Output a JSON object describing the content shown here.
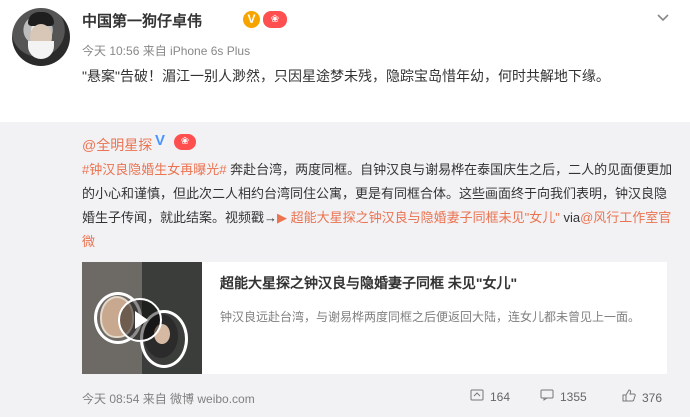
{
  "post": {
    "author": "中国第一狗仔卓伟",
    "verified_badge": "V",
    "vip_badge": "❀",
    "meta": "今天 10:56 来自 iPhone 6s Plus",
    "text": "\"悬案\"告破！湄江一别人渺然，只因星途梦未残，隐踪宝岛惜年幼，何时共解地下缘。",
    "menu_icon": "chevron-down-icon"
  },
  "repost": {
    "author": "@全明星探",
    "verified_badge": "V",
    "vip_badge": "❀",
    "hashtag": "#钟汉良隐婚生女再曝光#",
    "body": " 奔赴台湾，两度同框。自钟汉良与谢易桦在泰国庆生之后，二人的见面便更加的小心和谨慎，但此次二人相约台湾同住公寓，更是有同框合体。这些画面终于向我们表明，钟汉良隐婚生子传闻，就此结案。视频戳→",
    "video_link": "超能大星探之钟汉良与隐婚妻子同框未见\"女儿\"",
    "via_prefix": " via",
    "via_link": "@风行工作室官微",
    "card": {
      "title": "超能大星探之钟汉良与隐婚妻子同框 未见\"女儿\"",
      "description": "钟汉良远赴台湾，与谢易桦两度同框之后便返回大陆，连女儿都未曾见上一面。",
      "play_icon": "play-icon"
    },
    "meta": "今天 08:54 来自 微博 weibo.com",
    "actions": {
      "repost_count": "164",
      "comment_count": "1355",
      "like_count": "376",
      "repost_icon": "share-icon",
      "comment_icon": "comment-icon",
      "like_icon": "thumbs-up-icon"
    }
  }
}
